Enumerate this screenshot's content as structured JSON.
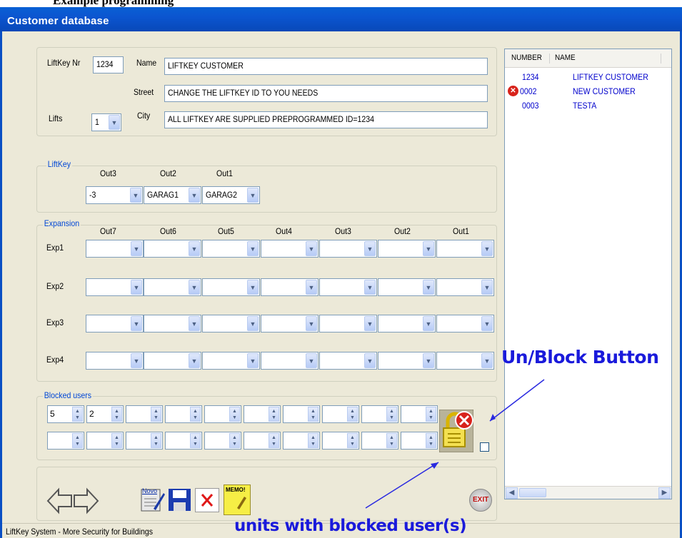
{
  "header_fragment": "Example programming",
  "window": {
    "title": "Customer database"
  },
  "customer": {
    "liftkey_label": "LiftKey Nr",
    "liftkey_value": "1234",
    "name_label": "Name",
    "name_value": "LIFTKEY CUSTOMER",
    "street_label": "Street",
    "street_value": "CHANGE THE LIFTKEY ID TO YOU NEEDS",
    "lifts_label": "Lifts",
    "lifts_value": "1",
    "city_label": "City",
    "city_value": "ALL LIFTKEY ARE SUPPLIED PREPROGRAMMED ID=1234"
  },
  "liftkey": {
    "title": "LiftKey",
    "outs": [
      {
        "label": "Out3",
        "value": "-3"
      },
      {
        "label": "Out2",
        "value": "GARAG1"
      },
      {
        "label": "Out1",
        "value": "GARAG2"
      }
    ]
  },
  "expansion": {
    "title": "Expansion",
    "columns": [
      "Out7",
      "Out6",
      "Out5",
      "Out4",
      "Out3",
      "Out2",
      "Out1"
    ],
    "rows": [
      "Exp1",
      "Exp2",
      "Exp3",
      "Exp4"
    ]
  },
  "blocked": {
    "title": "Blocked users",
    "row1": [
      "5",
      "2",
      "",
      "",
      "",
      "",
      "",
      "",
      "",
      ""
    ],
    "row2": [
      "",
      "",
      "",
      "",
      "",
      "",
      "",
      "",
      "",
      ""
    ]
  },
  "list": {
    "col_number": "NUMBER",
    "col_name": "NAME",
    "rows": [
      {
        "number": "1234",
        "name": "LIFTKEY CUSTOMER",
        "blocked": false
      },
      {
        "number": "0002",
        "name": "NEW CUSTOMER",
        "blocked": true
      },
      {
        "number": "0003",
        "name": "TESTA",
        "blocked": false
      }
    ]
  },
  "toolbar": {
    "memo_label": "MEMO!",
    "novo_label": "Novo",
    "exit_label": "EXIT"
  },
  "annotations": {
    "unblock": "Un/Block Button",
    "units_blocked": "units with blocked user(s)"
  },
  "status": {
    "text": "LiftKey System - More Security for Buildings"
  },
  "colors": {
    "titlebar": "#0a55d0",
    "accent": "#0046d5",
    "list_text": "#0000cc",
    "annotation": "#1a1adb",
    "error": "#d8231b"
  }
}
